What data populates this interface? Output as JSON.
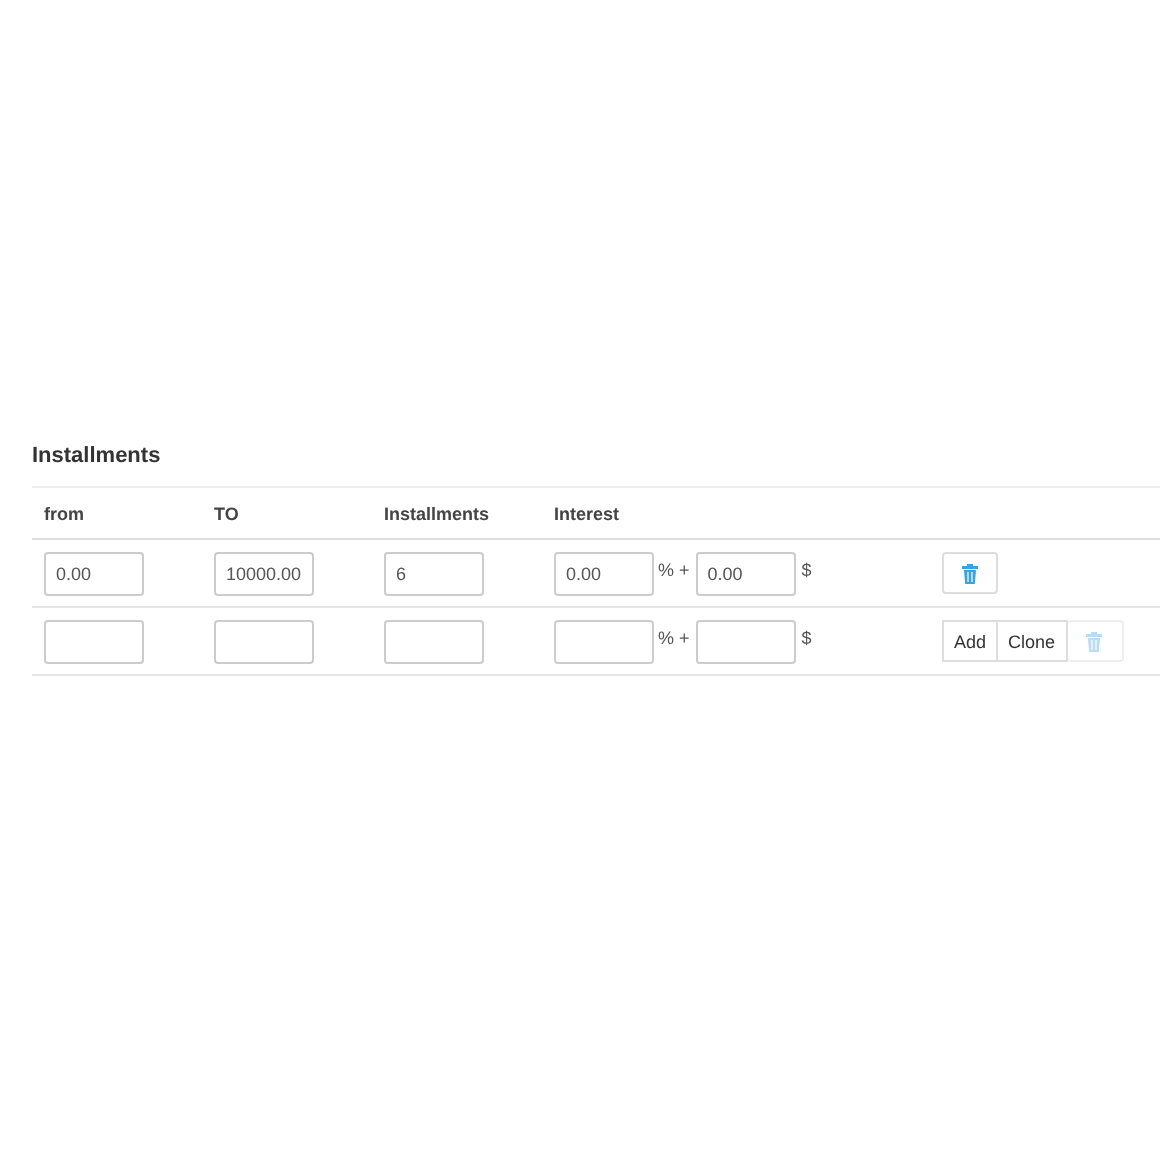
{
  "section_title": "Installments",
  "columns": [
    "from",
    "TO",
    "Installments",
    "Interest"
  ],
  "rows": [
    {
      "from": "0.00",
      "to": "10000.00",
      "installments": "6",
      "interest_percent": "0.00",
      "interest_fixed": "0.00",
      "percent_sign": "% +",
      "currency": "$",
      "actions": [
        {
          "kind": "delete",
          "disabled": false
        }
      ]
    },
    {
      "percent_sign": "% +",
      "currency": "$",
      "actions": [
        {
          "kind": "text",
          "label": "Add"
        },
        {
          "kind": "text",
          "label": "Clone"
        },
        {
          "kind": "delete",
          "disabled": true
        }
      ]
    }
  ]
}
